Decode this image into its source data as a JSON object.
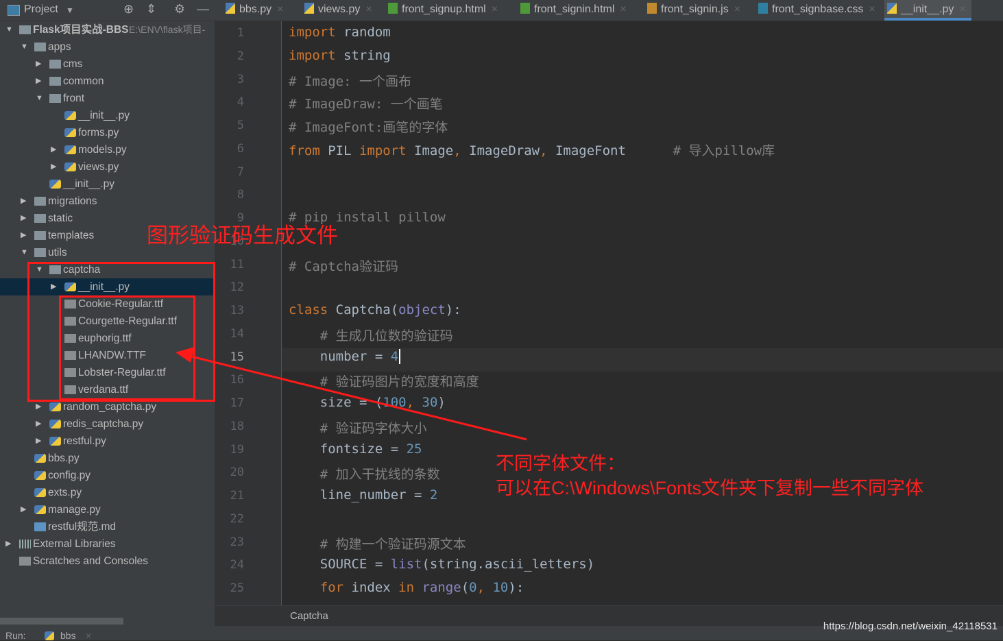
{
  "project_header": {
    "title": "Project"
  },
  "tabs": [
    {
      "label": "bbs.py",
      "type": "py"
    },
    {
      "label": "views.py",
      "type": "py"
    },
    {
      "label": "front_signup.html",
      "type": "html"
    },
    {
      "label": "front_signin.html",
      "type": "html"
    },
    {
      "label": "front_signin.js",
      "type": "js"
    },
    {
      "label": "front_signbase.css",
      "type": "css"
    },
    {
      "label": "__init__.py",
      "type": "py",
      "active": true
    }
  ],
  "tree": [
    {
      "label": "Flask项目实战-BBS",
      "path": "E:\\ENV\\flask项目-",
      "level": 0,
      "arrow": "▼",
      "icon": "folder"
    },
    {
      "label": "apps",
      "level": 1,
      "arrow": "▼",
      "icon": "folder"
    },
    {
      "label": "cms",
      "level": 2,
      "arrow": "▶",
      "icon": "folder"
    },
    {
      "label": "common",
      "level": 2,
      "arrow": "▶",
      "icon": "folder"
    },
    {
      "label": "front",
      "level": 2,
      "arrow": "▼",
      "icon": "folder"
    },
    {
      "label": "__init__.py",
      "level": 3,
      "arrow": "",
      "icon": "py"
    },
    {
      "label": "forms.py",
      "level": 3,
      "arrow": "",
      "icon": "py"
    },
    {
      "label": "models.py",
      "level": 3,
      "arrow": "▶",
      "icon": "py"
    },
    {
      "label": "views.py",
      "level": 3,
      "arrow": "▶",
      "icon": "py"
    },
    {
      "label": "__init__.py",
      "level": 2,
      "arrow": "",
      "icon": "py"
    },
    {
      "label": "migrations",
      "level": 1,
      "arrow": "▶",
      "icon": "folder"
    },
    {
      "label": "static",
      "level": 1,
      "arrow": "▶",
      "icon": "folder"
    },
    {
      "label": "templates",
      "level": 1,
      "arrow": "▶",
      "icon": "folder"
    },
    {
      "label": "utils",
      "level": 1,
      "arrow": "▼",
      "icon": "folder"
    },
    {
      "label": "captcha",
      "level": 2,
      "arrow": "▼",
      "icon": "folder"
    },
    {
      "label": "__init__.py",
      "level": 3,
      "arrow": "▶",
      "icon": "py",
      "selected": true
    },
    {
      "label": "Cookie-Regular.ttf",
      "level": 3,
      "arrow": "",
      "icon": "font"
    },
    {
      "label": "Courgette-Regular.ttf",
      "level": 3,
      "arrow": "",
      "icon": "font"
    },
    {
      "label": "euphorig.ttf",
      "level": 3,
      "arrow": "",
      "icon": "font"
    },
    {
      "label": "LHANDW.TTF",
      "level": 3,
      "arrow": "",
      "icon": "font"
    },
    {
      "label": "Lobster-Regular.ttf",
      "level": 3,
      "arrow": "",
      "icon": "font"
    },
    {
      "label": "verdana.ttf",
      "level": 3,
      "arrow": "",
      "icon": "font"
    },
    {
      "label": "random_captcha.py",
      "level": 2,
      "arrow": "▶",
      "icon": "py"
    },
    {
      "label": "redis_captcha.py",
      "level": 2,
      "arrow": "▶",
      "icon": "py"
    },
    {
      "label": "restful.py",
      "level": 2,
      "arrow": "▶",
      "icon": "py"
    },
    {
      "label": "bbs.py",
      "level": 1,
      "arrow": "",
      "icon": "py"
    },
    {
      "label": "config.py",
      "level": 1,
      "arrow": "",
      "icon": "py"
    },
    {
      "label": "exts.py",
      "level": 1,
      "arrow": "",
      "icon": "py"
    },
    {
      "label": "manage.py",
      "level": 1,
      "arrow": "▶",
      "icon": "py"
    },
    {
      "label": "restful规范.md",
      "level": 1,
      "arrow": "",
      "icon": "md"
    },
    {
      "label": "External Libraries",
      "level": 0,
      "arrow": "▶",
      "icon": "lib"
    },
    {
      "label": "Scratches and Consoles",
      "level": 0,
      "arrow": "",
      "icon": "scratch"
    }
  ],
  "editor": {
    "current_line": 15,
    "lines": [
      [
        [
          "kw",
          "import"
        ],
        [
          "df",
          " random"
        ]
      ],
      [
        [
          "kw",
          "import"
        ],
        [
          "df",
          " string"
        ]
      ],
      [
        [
          "cm",
          "# Image: 一个画布"
        ]
      ],
      [
        [
          "cm",
          "# ImageDraw: 一个画笔"
        ]
      ],
      [
        [
          "cm",
          "# ImageFont:画笔的字体"
        ]
      ],
      [
        [
          "kw",
          "from"
        ],
        [
          "df",
          " PIL "
        ],
        [
          "kw",
          "import"
        ],
        [
          "df",
          " Image"
        ],
        [
          "kw",
          ","
        ],
        [
          "df",
          " ImageDraw"
        ],
        [
          "kw",
          ","
        ],
        [
          "df",
          " ImageFont      "
        ],
        [
          "cm",
          "# 导入pillow库"
        ]
      ],
      [],
      [],
      [
        [
          "cm",
          "# pip install pillow"
        ]
      ],
      [],
      [
        [
          "cm",
          "# Captcha验证码"
        ]
      ],
      [],
      [
        [
          "kw",
          "class"
        ],
        [
          "df",
          " Captcha("
        ],
        [
          "bi",
          "object"
        ],
        [
          "df",
          "):"
        ]
      ],
      [
        [
          "cm",
          "    # 生成几位数的验证码"
        ]
      ],
      [
        [
          "df",
          "    number = "
        ],
        [
          "nm",
          "4"
        ]
      ],
      [
        [
          "cm",
          "    # 验证码图片的宽度和高度"
        ]
      ],
      [
        [
          "df",
          "    size = ("
        ],
        [
          "nm",
          "100"
        ],
        [
          "kw",
          ", "
        ],
        [
          "nm",
          "30"
        ],
        [
          "df",
          ")"
        ]
      ],
      [
        [
          "cm",
          "    # 验证码字体大小"
        ]
      ],
      [
        [
          "df",
          "    fontsize = "
        ],
        [
          "nm",
          "25"
        ]
      ],
      [
        [
          "cm",
          "    # 加入干扰线的条数"
        ]
      ],
      [
        [
          "df",
          "    line_number = "
        ],
        [
          "nm",
          "2"
        ]
      ],
      [],
      [
        [
          "cm",
          "    # 构建一个验证码源文本"
        ]
      ],
      [
        [
          "df",
          "    SOURCE = "
        ],
        [
          "bi",
          "list"
        ],
        [
          "df",
          "(string.ascii_letters)"
        ]
      ],
      [
        [
          "kw",
          "    for"
        ],
        [
          "df",
          " index "
        ],
        [
          "kw",
          "in"
        ],
        [
          "bi",
          " range"
        ],
        [
          "df",
          "("
        ],
        [
          "nm",
          "0"
        ],
        [
          "kw",
          ", "
        ],
        [
          "nm",
          "10"
        ],
        [
          "df",
          "):"
        ]
      ]
    ]
  },
  "breadcrumb": "Captcha",
  "bottom": {
    "run_label": "Run:",
    "run_tab": "bbs"
  },
  "annotations": {
    "title": "图形验证码生成文件",
    "note_line1": "不同字体文件：",
    "note_line2": "可以在C:\\Windows\\Fonts文件夹下复制一些不同字体",
    "color": "#ff2020"
  },
  "watermark": "https://blog.csdn.net/weixin_42118531"
}
